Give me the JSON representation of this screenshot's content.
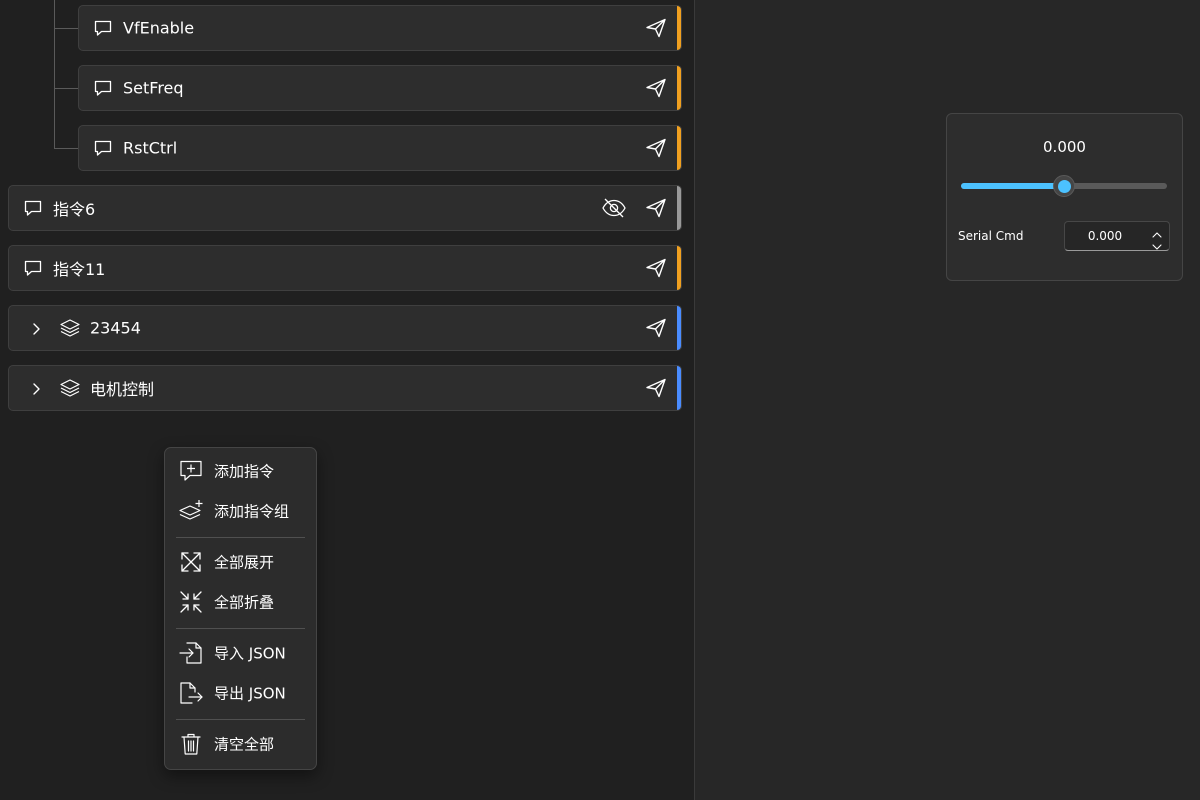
{
  "command_list": {
    "children": [
      {
        "label": "VfEnable",
        "accent": "#f0a020"
      },
      {
        "label": "SetFreq",
        "accent": "#f0a020"
      },
      {
        "label": "RstCtrl",
        "accent": "#f0a020"
      }
    ],
    "items": [
      {
        "label": "指令6",
        "accent": "#9a9a9a",
        "hidden": true
      },
      {
        "label": "指令11",
        "accent": "#f0a020"
      }
    ],
    "groups": [
      {
        "label": "23454",
        "accent": "#4a8cff"
      },
      {
        "label": "电机控制",
        "accent": "#4a8cff"
      }
    ]
  },
  "context_menu": {
    "add_command": "添加指令",
    "add_group": "添加指令组",
    "expand_all": "全部展开",
    "collapse_all": "全部折叠",
    "import_json": "导入 JSON",
    "export_json": "导出 JSON",
    "clear_all": "清空全部"
  },
  "parameter_panel": {
    "value_display": "0.000",
    "slider_fraction": 0.5,
    "name": "Serial Cmd",
    "input_value": "0.000"
  },
  "colors": {
    "accent_orange": "#f0a020",
    "accent_gray": "#9a9a9a",
    "accent_blue": "#4a8cff",
    "slider_accent": "#4cc2ff"
  }
}
